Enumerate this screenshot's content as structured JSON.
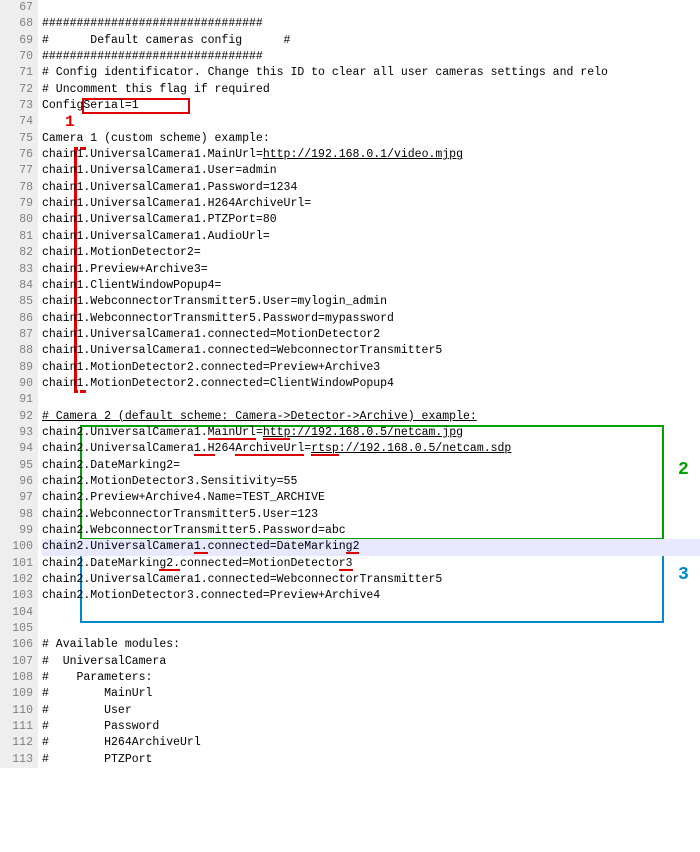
{
  "lines": [
    {
      "n": 67,
      "t": ""
    },
    {
      "n": 68,
      "t": "################################"
    },
    {
      "n": 69,
      "t": "#      Default cameras config      #"
    },
    {
      "n": 70,
      "t": "################################"
    },
    {
      "n": 71,
      "t": "# Config identificator. Change this ID to clear all user cameras settings and relo"
    },
    {
      "n": 72,
      "t": "# Uncomment this flag if required"
    },
    {
      "n": 73,
      "t": "ConfigSerial=1"
    },
    {
      "n": 74,
      "t": ""
    },
    {
      "n": 75,
      "t": "Camera 1 (custom scheme) example:"
    },
    {
      "n": 76,
      "seg": [
        {
          "t": "chain1.UniversalCamera1.MainUrl="
        },
        {
          "t": "http://192.168.0.1/video.mjpg",
          "u": 1
        }
      ]
    },
    {
      "n": 77,
      "t": "chain1.UniversalCamera1.User=admin"
    },
    {
      "n": 78,
      "t": "chain1.UniversalCamera1.Password=1234"
    },
    {
      "n": 79,
      "t": "chain1.UniversalCamera1.H264ArchiveUrl="
    },
    {
      "n": 80,
      "t": "chain1.UniversalCamera1.PTZPort=80"
    },
    {
      "n": 81,
      "t": "chain1.UniversalCamera1.AudioUrl="
    },
    {
      "n": 82,
      "t": "chain1.MotionDetector2="
    },
    {
      "n": 83,
      "t": "chain1.Preview+Archive3="
    },
    {
      "n": 84,
      "t": "chain1.ClientWindowPopup4="
    },
    {
      "n": 85,
      "t": "chain1.WebconnectorTransmitter5.User=mylogin_admin"
    },
    {
      "n": 86,
      "t": "chain1.WebconnectorTransmitter5.Password=mypassword"
    },
    {
      "n": 87,
      "t": "chain1.UniversalCamera1.connected=MotionDetector2"
    },
    {
      "n": 88,
      "t": "chain1.UniversalCamera1.connected=WebconnectorTransmitter5"
    },
    {
      "n": 89,
      "t": "chain1.MotionDetector2.connected=Preview+Archive3"
    },
    {
      "n": 90,
      "t": "chain1.MotionDetector2.connected=ClientWindowPopup4"
    },
    {
      "n": 91,
      "t": ""
    },
    {
      "n": 92,
      "seg": [
        {
          "t": "# Camera 2 (default scheme: Camera->Detector->Archive) example:",
          "u": 1
        }
      ]
    },
    {
      "n": 93,
      "seg": [
        {
          "t": "chain2.UniversalCamera1."
        },
        {
          "t": "MainUrl",
          "s": 1
        },
        {
          "t": "="
        },
        {
          "t": "http",
          "s": 1,
          "u": 1
        },
        {
          "t": "://192.168.0.5/netcam.jpg",
          "u": 1
        }
      ]
    },
    {
      "n": 94,
      "seg": [
        {
          "t": "chain2.UniversalCamera"
        },
        {
          "t": "1.H",
          "s": 1
        },
        {
          "t": "264"
        },
        {
          "t": "ArchiveUrl",
          "s": 1
        },
        {
          "t": "="
        },
        {
          "t": "rtsp",
          "s": 1,
          "u": 1
        },
        {
          "t": "://192.168.0.5/netcam.sdp",
          "u": 1
        }
      ]
    },
    {
      "n": 95,
      "t": "chain2.DateMarking2="
    },
    {
      "n": 96,
      "t": "chain2.MotionDetector3.Sensitivity=55"
    },
    {
      "n": 97,
      "t": "chain2.Preview+Archive4.Name=TEST_ARCHIVE"
    },
    {
      "n": 98,
      "t": "chain2.WebconnectorTransmitter5.User=123"
    },
    {
      "n": 99,
      "t": "chain2.WebconnectorTransmitter5.Password=abc"
    },
    {
      "n": 100,
      "seg": [
        {
          "t": "chain2.UniversalCamera"
        },
        {
          "t": "1.",
          "s": 1
        },
        {
          "t": "connected=DateMarkin"
        },
        {
          "t": "g2",
          "s": 1
        }
      ],
      "hl": 1
    },
    {
      "n": 101,
      "seg": [
        {
          "t": "chain2.DateMarkin"
        },
        {
          "t": "g2.",
          "s": 1
        },
        {
          "t": "connected=MotionDetecto"
        },
        {
          "t": "r3",
          "s": 1
        }
      ]
    },
    {
      "n": 102,
      "t": "chain2.UniversalCamera1.connected=WebconnectorTransmitter5"
    },
    {
      "n": 103,
      "t": "chain2.MotionDetector3.connected=Preview+Archive4"
    },
    {
      "n": 104,
      "t": ""
    },
    {
      "n": 105,
      "t": ""
    },
    {
      "n": 106,
      "t": "# Available modules:"
    },
    {
      "n": 107,
      "t": "#  UniversalCamera"
    },
    {
      "n": 108,
      "t": "#    Parameters:"
    },
    {
      "n": 109,
      "t": "#        MainUrl"
    },
    {
      "n": 110,
      "t": "#        User"
    },
    {
      "n": 111,
      "t": "#        Password"
    },
    {
      "n": 112,
      "t": "#        H264ArchiveUrl"
    },
    {
      "n": 113,
      "t": "#        PTZPort"
    }
  ],
  "annotations": {
    "label1": "1",
    "label2": "2",
    "label3": "3"
  }
}
